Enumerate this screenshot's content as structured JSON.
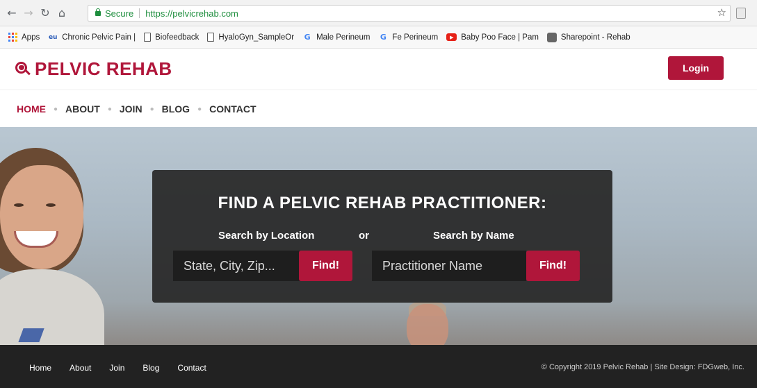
{
  "browser": {
    "secure_label": "Secure",
    "url": "https://pelvicrehab.com",
    "bookmarks": [
      {
        "label": "Apps",
        "icon": "apps-grid-icon"
      },
      {
        "label": "Chronic Pelvic Pain |",
        "icon": "eu-icon"
      },
      {
        "label": "Biofeedback",
        "icon": "page-icon"
      },
      {
        "label": "HyaloGyn_SampleOr",
        "icon": "page-icon"
      },
      {
        "label": "Male Perineum",
        "icon": "google-icon"
      },
      {
        "label": "Fe Perineum",
        "icon": "google-icon"
      },
      {
        "label": "Baby Poo Face | Pam",
        "icon": "youtube-icon"
      },
      {
        "label": "Sharepoint - Rehab",
        "icon": "sharepoint-icon"
      }
    ]
  },
  "header": {
    "logo_text": "PELVIC REHAB",
    "login_label": "Login"
  },
  "nav": {
    "items": [
      "HOME",
      "ABOUT",
      "JOIN",
      "BLOG",
      "CONTACT"
    ],
    "active": "HOME"
  },
  "search": {
    "title": "FIND A PELVIC REHAB PRACTITIONER:",
    "location_label": "Search by Location",
    "or_label": "or",
    "name_label": "Search by Name",
    "location_placeholder": "State, City, Zip...",
    "name_placeholder": "Practitioner Name",
    "find_label": "Find!"
  },
  "footer": {
    "links": [
      "Home",
      "About",
      "Join",
      "Blog",
      "Contact"
    ],
    "copyright": "© Copyright 2019 Pelvic Rehab | Site Design: FDGweb, Inc."
  },
  "colors": {
    "brand": "#b0163a",
    "panel": "#282828",
    "footer": "#222222"
  }
}
